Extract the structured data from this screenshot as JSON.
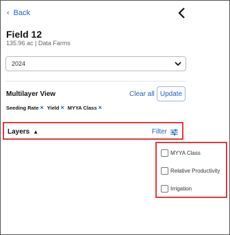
{
  "nav": {
    "back_label": "Back"
  },
  "field": {
    "name": "Field 12",
    "subtitle": "135.96 ac | Data Farms"
  },
  "year_select": {
    "value": "2024"
  },
  "multilayer": {
    "title": "Multilayer View",
    "clear_all_label": "Clear all",
    "update_label": "Update",
    "tags": [
      "Seeding Rate",
      "Yield",
      "MYYA Class"
    ]
  },
  "layers": {
    "label": "Layers",
    "filter_label": "Filter"
  },
  "filter_options": [
    "MYYA Class",
    "Relative Productivity",
    "Irrigation"
  ],
  "colors": {
    "accent": "#1a5fc1",
    "highlight": "#e03a3a"
  }
}
